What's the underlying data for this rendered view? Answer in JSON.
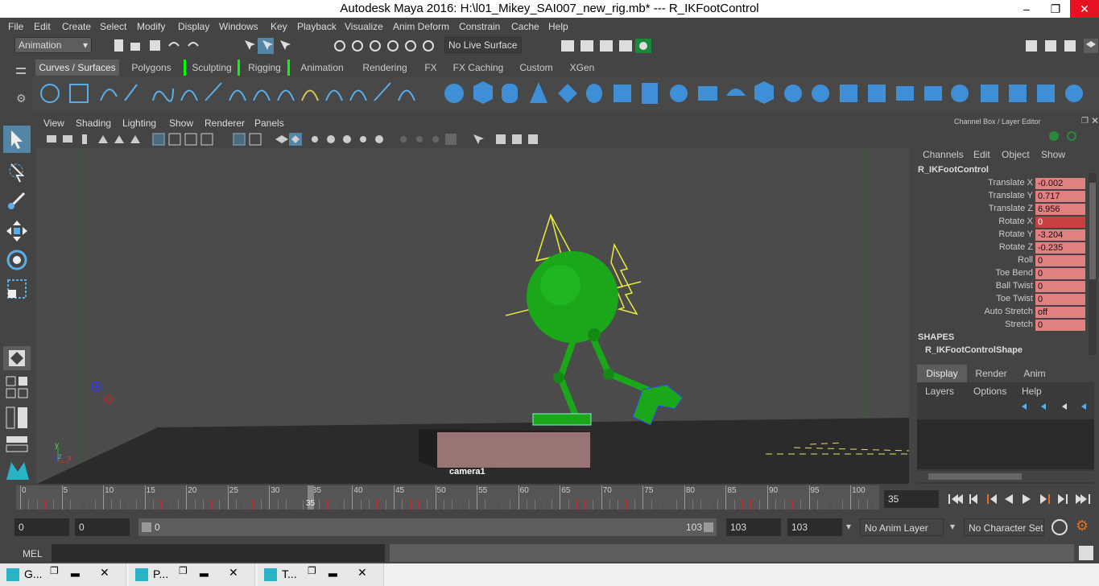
{
  "window": {
    "title": "Autodesk Maya 2016: H:\\l01_Mikey_SAI007_new_rig.mb*   ---   R_IKFootControl"
  },
  "menu": [
    "File",
    "Edit",
    "Create",
    "Select",
    "Modify",
    "Display",
    "Windows",
    "Key",
    "Playback",
    "Visualize",
    "Anim Deform",
    "Constrain",
    "Cache",
    "Help"
  ],
  "status": {
    "mode": "Animation",
    "live_surface": "No Live Surface"
  },
  "shelf_tabs": [
    "Curves / Surfaces",
    "Polygons",
    "Sculpting",
    "Rigging",
    "Animation",
    "Rendering",
    "FX",
    "FX Caching",
    "Custom",
    "XGen"
  ],
  "viewport": {
    "menu": [
      "View",
      "Shading",
      "Lighting",
      "Show",
      "Renderer",
      "Panels"
    ],
    "camera_label": "camera1",
    "axis_x": "x",
    "axis_y": "y",
    "axis_z": "z"
  },
  "channel_box": {
    "header": "Channel Box / Layer Editor",
    "menu": [
      "Channels",
      "Edit",
      "Object",
      "Show"
    ],
    "object_name": "R_IKFootControl",
    "attributes": [
      {
        "label": "Translate X",
        "value": "-0.002"
      },
      {
        "label": "Translate Y",
        "value": "0.717"
      },
      {
        "label": "Translate Z",
        "value": "6.956"
      },
      {
        "label": "Rotate X",
        "value": "0"
      },
      {
        "label": "Rotate Y",
        "value": "-3.204"
      },
      {
        "label": "Rotate Z",
        "value": "-0.235"
      },
      {
        "label": "Roll",
        "value": "0"
      },
      {
        "label": "Toe Bend",
        "value": "0"
      },
      {
        "label": "Ball Twist",
        "value": "0"
      },
      {
        "label": "Toe Twist",
        "value": "0"
      },
      {
        "label": "Auto Stretch",
        "value": "off"
      },
      {
        "label": "Stretch",
        "value": "0"
      }
    ],
    "shapes_label": "SHAPES",
    "shape_name": "R_IKFootControlShape",
    "layer_tabs": [
      "Display",
      "Render",
      "Anim"
    ],
    "layer_menu": [
      "Layers",
      "Options",
      "Help"
    ]
  },
  "timeline": {
    "ticks": [
      "0",
      "5",
      "10",
      "15",
      "20",
      "25",
      "30",
      "35",
      "40",
      "45",
      "50",
      "55",
      "60",
      "65",
      "70",
      "75",
      "80",
      "85",
      "90",
      "95",
      "100"
    ],
    "current_frame": "35",
    "current_field": "35"
  },
  "range": {
    "start": "0",
    "playback_start": "0",
    "slider_start": "0",
    "slider_end": "103",
    "playback_end": "103",
    "end": "103",
    "anim_layer": "No Anim Layer",
    "character_set": "No Character Set"
  },
  "command": {
    "lang": "MEL"
  },
  "taskbar": [
    {
      "label": "G..."
    },
    {
      "label": "P..."
    },
    {
      "label": "T..."
    }
  ]
}
